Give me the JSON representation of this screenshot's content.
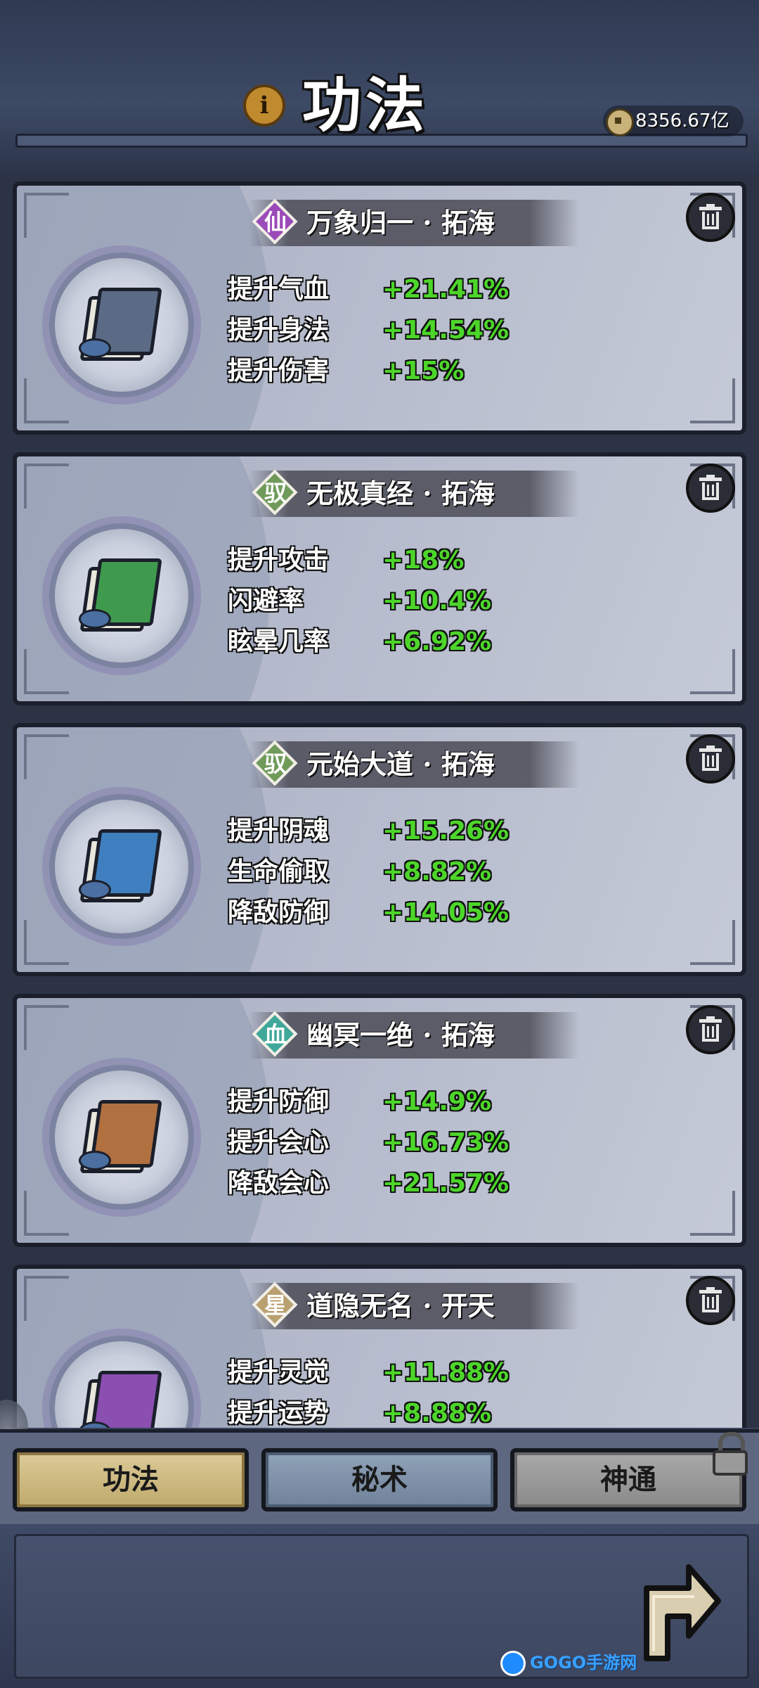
{
  "header": {
    "title": "功法",
    "info_icon": "info-icon",
    "currency": {
      "icon": "coin-icon",
      "value": "8356.67亿"
    }
  },
  "cards": [
    {
      "grade": "仙",
      "grade_color": "#9b4bb8",
      "name": "万象归一 · 拓海",
      "book_color": "#5b6b85",
      "stats": [
        {
          "label": "提升气血",
          "value": "+21.41%"
        },
        {
          "label": "提升身法",
          "value": "+14.54%"
        },
        {
          "label": "提升伤害",
          "value": "+15%"
        }
      ]
    },
    {
      "grade": "驭",
      "grade_color": "#6f9a5a",
      "name": "无极真经 · 拓海",
      "book_color": "#3f9a4e",
      "stats": [
        {
          "label": "提升攻击",
          "value": "+18%"
        },
        {
          "label": "闪避率",
          "value": "+10.4%"
        },
        {
          "label": "眩晕几率",
          "value": "+6.92%"
        }
      ]
    },
    {
      "grade": "驭",
      "grade_color": "#6f9a5a",
      "name": "元始大道 · 拓海",
      "book_color": "#3f7fbf",
      "stats": [
        {
          "label": "提升阴魂",
          "value": "+15.26%"
        },
        {
          "label": "生命偷取",
          "value": "+8.82%"
        },
        {
          "label": "降敌防御",
          "value": "+14.05%"
        }
      ]
    },
    {
      "grade": "血",
      "grade_color": "#3fa89a",
      "name": "幽冥一绝 · 拓海",
      "book_color": "#b07040",
      "stats": [
        {
          "label": "提升防御",
          "value": "+14.9%"
        },
        {
          "label": "提升会心",
          "value": "+16.73%"
        },
        {
          "label": "降敌会心",
          "value": "+21.57%"
        }
      ]
    },
    {
      "grade": "星",
      "grade_color": "#b9a070",
      "name": "道隐无名 · 开天",
      "book_color": "#8a4fb0",
      "stats": [
        {
          "label": "提升灵觉",
          "value": "+11.88%"
        },
        {
          "label": "提升运势",
          "value": "+8.88%"
        },
        {
          "label": "",
          "value": ""
        }
      ]
    }
  ],
  "tabs": [
    {
      "label": "功法",
      "active": true
    },
    {
      "label": "秘术",
      "active": false
    },
    {
      "label": "神通",
      "active": false,
      "locked": true
    }
  ],
  "footer": {
    "back_icon": "back-arrow-icon",
    "watermark": "GOGO手游网"
  }
}
